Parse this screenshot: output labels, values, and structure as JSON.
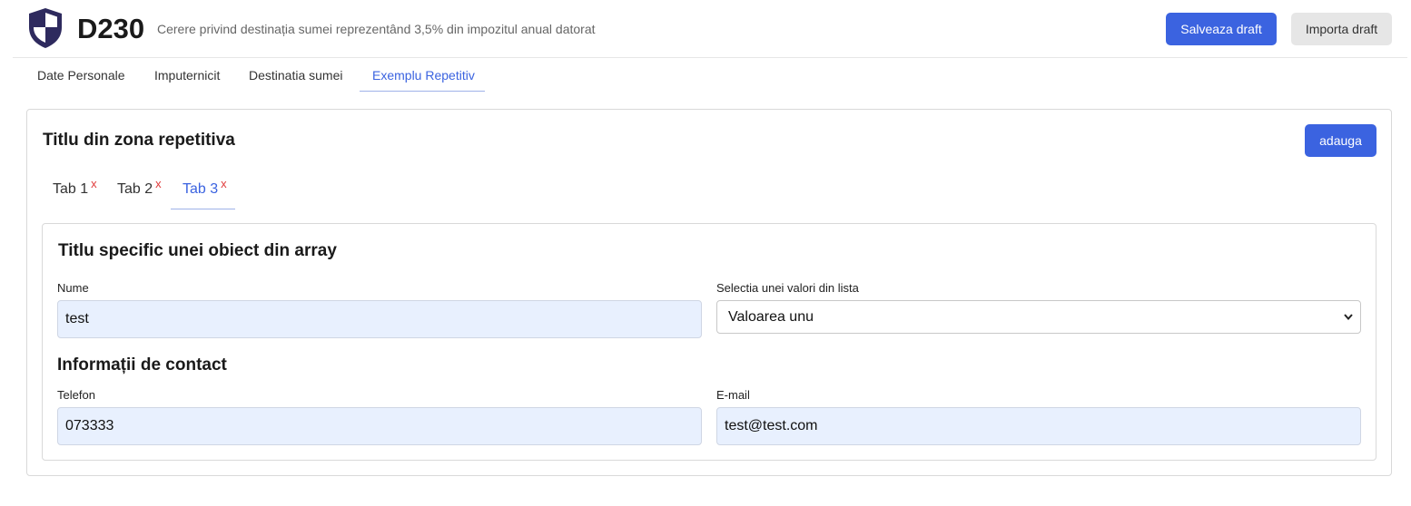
{
  "header": {
    "code": "D230",
    "description": "Cerere privind destinația sumei reprezentând 3,5% din impozitul anual datorat",
    "save_label": "Salveaza draft",
    "import_label": "Importa draft",
    "logo_icon": "shield-icon"
  },
  "main_tabs": [
    {
      "label": "Date Personale",
      "active": false
    },
    {
      "label": "Imputernicit",
      "active": false
    },
    {
      "label": "Destinatia sumei",
      "active": false
    },
    {
      "label": "Exemplu Repetitiv",
      "active": true
    }
  ],
  "repeat_zone": {
    "title": "Titlu din zona repetitiva",
    "add_label": "adauga",
    "tabs": [
      {
        "label": "Tab 1",
        "close": "x",
        "active": false
      },
      {
        "label": "Tab 2",
        "close": "x",
        "active": false
      },
      {
        "label": "Tab 3",
        "close": "x",
        "active": true
      }
    ]
  },
  "item": {
    "title": "Titlu specific unei obiect din array",
    "name_label": "Nume",
    "name_value": "test",
    "select_label": "Selectia unei valori din lista",
    "select_value": "Valoarea unu",
    "contact_title": "Informații de contact",
    "phone_label": "Telefon",
    "phone_value": "073333",
    "email_label": "E-mail",
    "email_value": "test@test.com"
  },
  "colors": {
    "primary": "#3b63e0",
    "input_bg": "#e8f0fe",
    "close_x": "#e03a3a",
    "logo_dark": "#2e2a5e"
  }
}
